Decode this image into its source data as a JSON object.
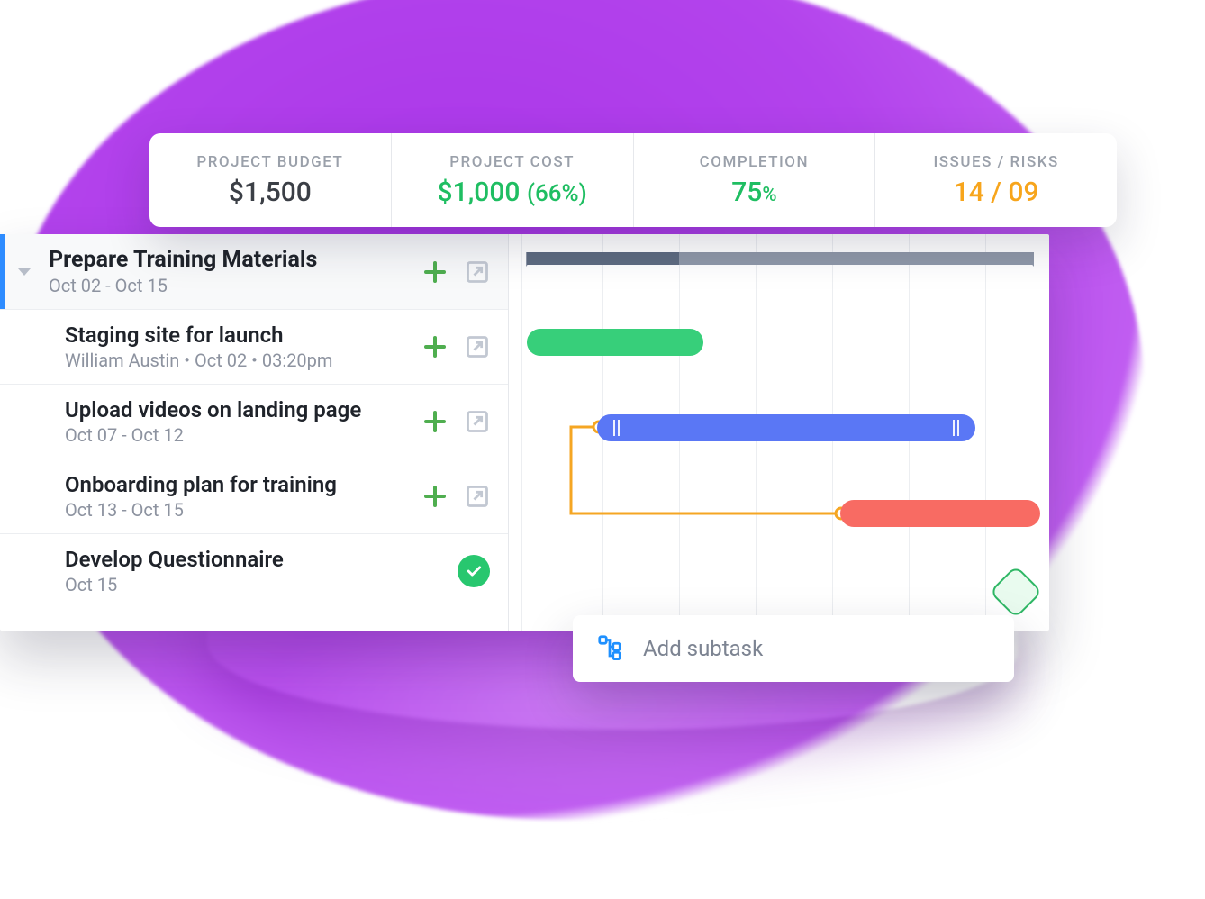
{
  "stats": {
    "budget": {
      "label": "PROJECT BUDGET",
      "value": "$1,500"
    },
    "cost": {
      "label": "PROJECT COST",
      "value": "$1,000",
      "pct": "(66%)"
    },
    "completion": {
      "label": "COMPLETION",
      "value": "75",
      "pctSym": "%"
    },
    "issues": {
      "label": "ISSUES / RISKS",
      "value": "14 / 09"
    }
  },
  "project": {
    "title": "Prepare Training Materials",
    "dates": "Oct 02 - Oct 15"
  },
  "tasks": [
    {
      "title": "Staging site for launch",
      "meta": "William Austin • Oct 02 • 03:20pm"
    },
    {
      "title": "Upload videos on landing page",
      "meta": "Oct 07 - Oct 12"
    },
    {
      "title": "Onboarding plan for training",
      "meta": "Oct 13 - Oct 15"
    },
    {
      "title": "Develop Questionnaire",
      "meta": "Oct 15",
      "done": true
    }
  ],
  "addSubtask": "Add subtask",
  "chart_data": {
    "type": "gantt",
    "range": {
      "start": "Oct 02",
      "end": "Oct 15"
    },
    "summary": {
      "name": "Prepare Training Materials",
      "start": "Oct 02",
      "end": "Oct 15",
      "progress": 0.3
    },
    "bars": [
      {
        "name": "Staging site for launch",
        "start": "Oct 02",
        "end": "Oct 06",
        "color": "#37cf7a"
      },
      {
        "name": "Upload videos on landing page",
        "start": "Oct 04",
        "end": "Oct 13",
        "color": "#5a77f5"
      },
      {
        "name": "Onboarding plan for training",
        "start": "Oct 10",
        "end": "Oct 15",
        "color": "#f86b63"
      },
      {
        "name": "Develop Questionnaire",
        "start": "Oct 15",
        "end": "Oct 15",
        "milestone": true,
        "color": "#2fb765"
      }
    ],
    "dependencies": [
      {
        "from": "Upload videos on landing page",
        "to": "Onboarding plan for training"
      }
    ]
  }
}
